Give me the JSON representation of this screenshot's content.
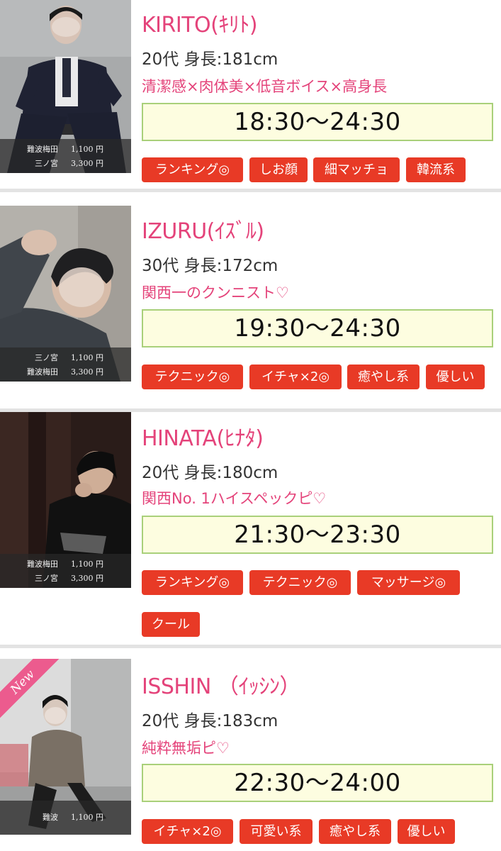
{
  "cards": [
    {
      "name": "KIRITO(ｷﾘﾄ)",
      "meta": "20代 身長:181cm",
      "catch": "清潔感×肉体美×低音ボイス×高身長",
      "time": "18:30〜24:30",
      "prices": [
        {
          "area": "難波梅田",
          "amount": "1,100 円"
        },
        {
          "area": "三ノ宮",
          "amount": "3,300 円"
        }
      ],
      "tags": [
        "ランキング◎",
        "しお顔",
        "細マッチョ",
        "韓流系"
      ]
    },
    {
      "name": "IZURU(ｲｽﾞﾙ)",
      "meta": "30代 身長:172cm",
      "catch": "関西一のクンニスト♡",
      "time": "19:30〜24:30",
      "prices": [
        {
          "area": "三ノ宮",
          "amount": "1,100 円"
        },
        {
          "area": "難波梅田",
          "amount": "3,300 円"
        }
      ],
      "tags": [
        "テクニック◎",
        "イチャ×2◎",
        "癒やし系",
        "優しい"
      ]
    },
    {
      "name": "HINATA(ﾋﾅﾀ)",
      "meta": "20代 身長:180cm",
      "catch": "関西No. 1ハイスペックピ♡",
      "time": "21:30〜23:30",
      "prices": [
        {
          "area": "難波梅田",
          "amount": "1,100 円"
        },
        {
          "area": "三ノ宮",
          "amount": "3,300 円"
        }
      ],
      "tags": [
        "ランキング◎",
        "テクニック◎",
        "マッサージ◎",
        "クール"
      ]
    },
    {
      "name": "ISSHIN （ｲｯｼﾝ）",
      "meta": "20代 身長:183cm",
      "catch": "純粋無垢ピ♡",
      "time": "22:30〜24:00",
      "badge": "New",
      "prices": [
        {
          "area": "難波",
          "amount": "1,100 円"
        }
      ],
      "tags": [
        "イチャ×2◎",
        "可愛い系",
        "癒やし系",
        "優しい"
      ]
    }
  ]
}
